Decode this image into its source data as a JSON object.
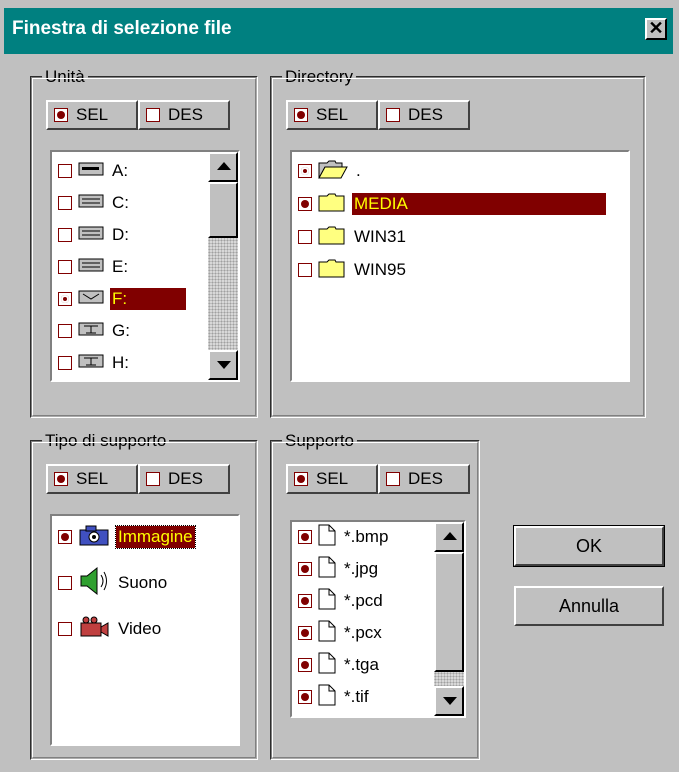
{
  "window": {
    "title": "Finestra di selezione file",
    "close": "✕"
  },
  "select_bar": {
    "sel": "SEL",
    "des": "DES"
  },
  "unita": {
    "legend": "Unità",
    "items": [
      {
        "label": "A:",
        "checked": false,
        "icon": "floppy-drive-icon"
      },
      {
        "label": "C:",
        "checked": false,
        "icon": "hard-drive-icon"
      },
      {
        "label": "D:",
        "checked": false,
        "icon": "hard-drive-icon"
      },
      {
        "label": "E:",
        "checked": false,
        "icon": "hard-drive-icon"
      },
      {
        "label": "F:",
        "checked": "partial",
        "icon": "removable-drive-icon",
        "selected": true
      },
      {
        "label": "G:",
        "checked": false,
        "icon": "network-drive-icon"
      },
      {
        "label": "H:",
        "checked": false,
        "icon": "network-drive-icon"
      }
    ]
  },
  "directory": {
    "legend": "Directory",
    "items": [
      {
        "label": ".",
        "checked": "partial",
        "icon": "open-folder-icon"
      },
      {
        "label": "MEDIA",
        "checked": true,
        "icon": "folder-icon",
        "selected": true
      },
      {
        "label": "WIN31",
        "checked": false,
        "icon": "folder-icon"
      },
      {
        "label": "WIN95",
        "checked": false,
        "icon": "folder-icon"
      }
    ]
  },
  "tipo": {
    "legend": "Tipo di supporto",
    "items": [
      {
        "label": "Immagine",
        "checked": true,
        "icon": "camera-icon",
        "selected": true
      },
      {
        "label": "Suono",
        "checked": false,
        "icon": "speaker-icon"
      },
      {
        "label": "Video",
        "checked": false,
        "icon": "video-camera-icon"
      }
    ]
  },
  "supporto": {
    "legend": "Supporto",
    "items": [
      {
        "label": "*.bmp",
        "checked": true
      },
      {
        "label": "*.jpg",
        "checked": true
      },
      {
        "label": "*.pcd",
        "checked": true
      },
      {
        "label": "*.pcx",
        "checked": true
      },
      {
        "label": "*.tga",
        "checked": true
      },
      {
        "label": "*.tif",
        "checked": true
      }
    ]
  },
  "buttons": {
    "ok": "OK",
    "cancel": "Annulla"
  }
}
